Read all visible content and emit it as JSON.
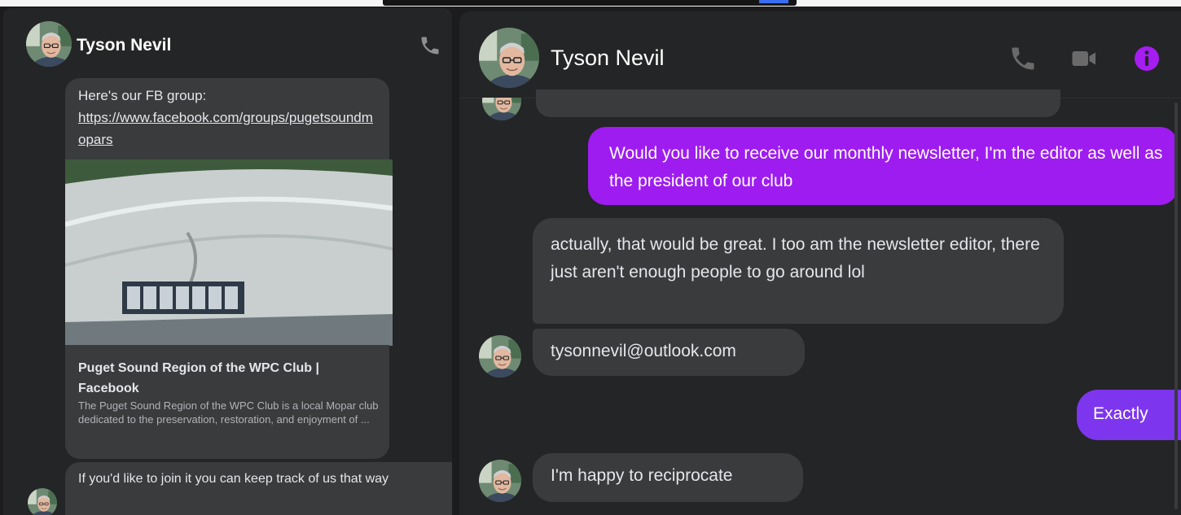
{
  "left_chat": {
    "contact_name": "Tyson Nevil",
    "messages": {
      "intro": "Here's our FB group:",
      "link": "https://www.facebook.com/groups/pugetsoundmopars",
      "link_card_title": "Puget Sound Region of the WPC Club | Facebook",
      "link_card_desc": "The Puget Sound Region of the WPC Club is a local Mopar club dedicated to the preservation, restoration, and enjoyment of ...",
      "follow_up": "If you'd like to join it you can keep track of us that way"
    },
    "icons": {
      "call": "phone-icon",
      "avatar": "avatar"
    }
  },
  "main_chat": {
    "contact_name": "Tyson Nevil",
    "header_icons": [
      "phone-icon",
      "video-icon",
      "info-icon"
    ],
    "accent_color": "#a51df0",
    "messages": [
      {
        "sender": "me",
        "text": "Would you like to receive our monthly newsletter, I'm the editor as well as the president of our club"
      },
      {
        "sender": "them",
        "text": "actually, that would be great. I too am the newsletter editor, there just aren't enough people to go around lol"
      },
      {
        "sender": "them",
        "text": "tysonnevil@outlook.com"
      },
      {
        "sender": "me",
        "text": "Exactly"
      },
      {
        "sender": "them",
        "text": "I'm happy to reciprocate"
      }
    ]
  }
}
